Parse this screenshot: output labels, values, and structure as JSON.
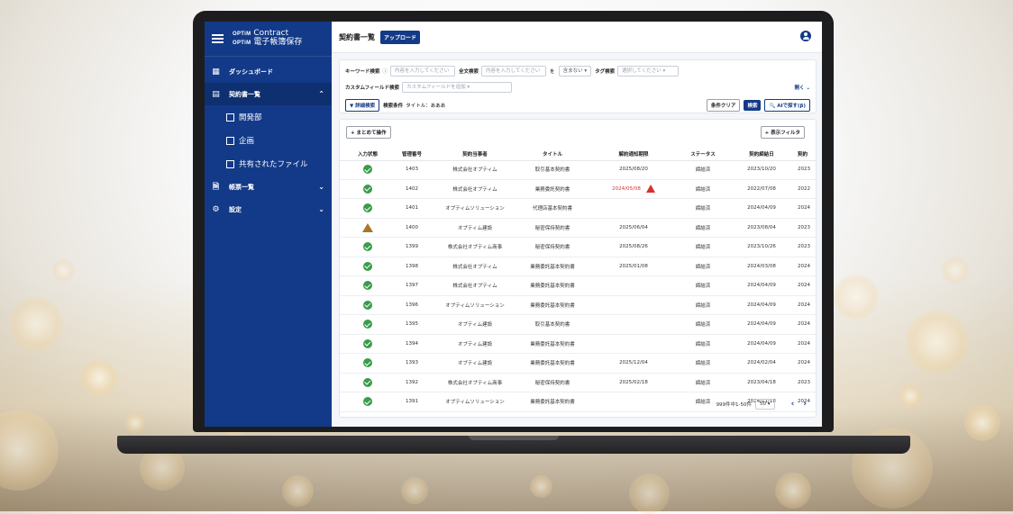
{
  "sidebar": {
    "brand_mark_top": "OPTiM",
    "brand_name_top": "Contract",
    "brand_mark_bottom": "OPTiM",
    "brand_name_bottom": "電子帳簿保存",
    "items": [
      {
        "label": "ダッシュボード",
        "icon": "dashboard-icon"
      },
      {
        "label": "契約書一覧",
        "icon": "document-list-icon"
      },
      {
        "label": "帳票一覧",
        "icon": "form-icon"
      },
      {
        "label": "設定",
        "icon": "gear-icon"
      }
    ],
    "sub_items": [
      "開発部",
      "企画",
      "共有されたファイル"
    ]
  },
  "header": {
    "title": "契約書一覧",
    "upload_label": "アップロード"
  },
  "search": {
    "keyword_label": "キーワード検索",
    "keyword_placeholder": "内容を入力してください",
    "fulltext_label": "全文検索",
    "fulltext_placeholder": "内容を入力してください",
    "fulltext_joiner": "を",
    "include_select": "含まない",
    "tag_label": "タグ検索",
    "tag_placeholder": "選択してください",
    "custom_label": "カスタムフィールド検索",
    "custom_placeholder": "カスタムフィールドを追加",
    "open_label": "開く",
    "detail_button": "詳細検索",
    "condition_label": "検索条件",
    "condition_value": "タイトル：あああ",
    "clear_button": "条件クリア",
    "search_button": "検索",
    "ai_button": "AIで探す(β)"
  },
  "table": {
    "bulk_action": "+ まとめて操作",
    "display_filter": "+ 表示フィルタ",
    "columns": [
      "入力状態",
      "管理番号",
      "契約当事者",
      "タイトル",
      "解約通知期限",
      "ステータス",
      "契約締結日",
      "契約"
    ],
    "rows": [
      {
        "state": "ok",
        "id": "1403",
        "party": "株式会社オプティム",
        "title": "取引基本契約書",
        "notice": "2025/08/20",
        "status": "締結済",
        "signed": "2023/10/20",
        "extra": "2023"
      },
      {
        "state": "ok",
        "id": "1402",
        "party": "株式会社オプティム",
        "title": "業務委託契約書",
        "notice": "2024/05/08",
        "status": "締結済",
        "signed": "2022/07/08",
        "extra": "2022",
        "overdue": true
      },
      {
        "state": "ok",
        "id": "1401",
        "party": "オプティムソリューション",
        "title": "代理店基本契約書",
        "notice": "",
        "status": "締結済",
        "signed": "2024/04/09",
        "extra": "2024"
      },
      {
        "state": "warn",
        "id": "1400",
        "party": "オプティム建設",
        "title": "秘密保持契約書",
        "notice": "2025/06/04",
        "status": "締結済",
        "signed": "2023/08/04",
        "extra": "2023"
      },
      {
        "state": "ok",
        "id": "1399",
        "party": "株式会社オプティム商事",
        "title": "秘密保持契約書",
        "notice": "2025/08/26",
        "status": "締結済",
        "signed": "2023/10/26",
        "extra": "2023"
      },
      {
        "state": "ok",
        "id": "1398",
        "party": "株式会社オプティム",
        "title": "業務委託基本契約書",
        "notice": "2025/01/08",
        "status": "締結済",
        "signed": "2024/03/08",
        "extra": "2024"
      },
      {
        "state": "ok",
        "id": "1397",
        "party": "株式会社オプティム",
        "title": "業務委託基本契約書",
        "notice": "",
        "status": "締結済",
        "signed": "2024/04/09",
        "extra": "2024"
      },
      {
        "state": "ok",
        "id": "1396",
        "party": "オプティムソリューション",
        "title": "業務委託基本契約書",
        "notice": "",
        "status": "締結済",
        "signed": "2024/04/09",
        "extra": "2024"
      },
      {
        "state": "ok",
        "id": "1395",
        "party": "オプティム建設",
        "title": "取引基本契約書",
        "notice": "",
        "status": "締結済",
        "signed": "2024/04/09",
        "extra": "2024"
      },
      {
        "state": "ok",
        "id": "1394",
        "party": "オプティム建設",
        "title": "業務委託基本契約書",
        "notice": "",
        "status": "締結済",
        "signed": "2024/04/09",
        "extra": "2024"
      },
      {
        "state": "ok",
        "id": "1393",
        "party": "オプティム建設",
        "title": "業務委託基本契約書",
        "notice": "2025/12/04",
        "status": "締結済",
        "signed": "2024/02/04",
        "extra": "2024"
      },
      {
        "state": "ok",
        "id": "1392",
        "party": "株式会社オプティム商事",
        "title": "秘密保持契約書",
        "notice": "2025/02/18",
        "status": "締結済",
        "signed": "2023/04/18",
        "extra": "2023"
      },
      {
        "state": "ok",
        "id": "1391",
        "party": "オプティムソリューション",
        "title": "業務委託基本契約書",
        "notice": "",
        "status": "締結済",
        "signed": "2024/11/18",
        "extra": "2024"
      }
    ]
  },
  "pager": {
    "summary": "999件中1-50件",
    "page_size": "50"
  },
  "colors": {
    "brand": "#133a88",
    "ok": "#3a9c4c",
    "warn": "#a8762a",
    "alert": "#d4322c"
  }
}
